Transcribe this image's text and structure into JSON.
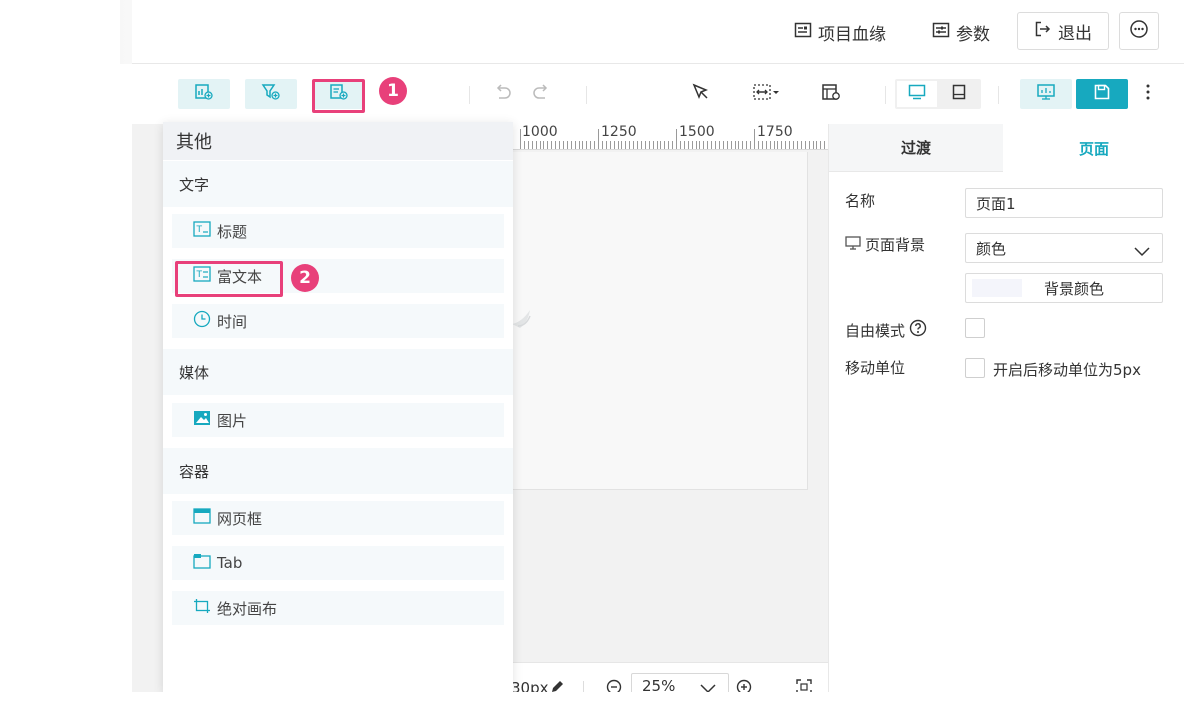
{
  "header": {
    "lineage": "项目血缘",
    "params": "参数",
    "exit": "退出"
  },
  "toolbar": {
    "badge1": "1",
    "badge2": "2"
  },
  "ruler": {
    "labels": [
      "1000",
      "1250",
      "1500",
      "1750"
    ]
  },
  "bottom": {
    "size_value": "30px",
    "zoom": "25%"
  },
  "panel": {
    "title": "其他",
    "sections": {
      "text": "文字",
      "media": "媒体",
      "container": "容器"
    },
    "items": {
      "heading": "标题",
      "richtext": "富文本",
      "time": "时间",
      "image": "图片",
      "webframe": "网页框",
      "tab": "Tab",
      "canvas": "绝对画布"
    }
  },
  "props": {
    "tabs": {
      "transition": "过渡",
      "page": "页面"
    },
    "name_label": "名称",
    "name_value": "页面1",
    "bg_label": "页面背景",
    "bg_value": "颜色",
    "bg_color_button": "背景颜色",
    "free_mode_label": "自由模式",
    "move_unit_label": "移动单位",
    "move_unit_hint": "开启后移动单位为5px"
  },
  "colors": {
    "accent": "#17a9bf",
    "highlight": "#e8407a",
    "light_accent": "#e3f3f5"
  }
}
